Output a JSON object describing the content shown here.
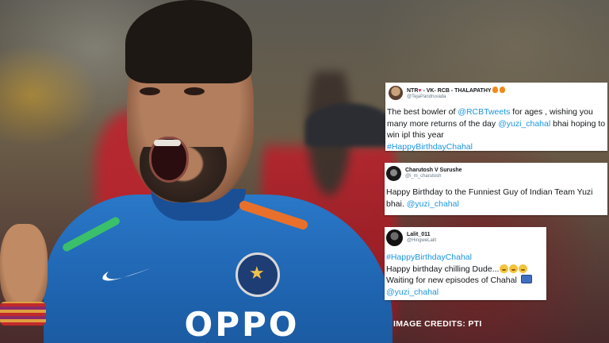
{
  "photo": {
    "sponsor_text": "OPPO"
  },
  "tweets": [
    {
      "display_name_before_heart": "NTR",
      "display_name_after_heart": " - VK- RCB - THALAPATHY ",
      "handle": "@TejaPandruvada",
      "parts": [
        {
          "text": "The best bowler of ",
          "link": false
        },
        {
          "text": "@RCBTweets",
          "link": true
        },
        {
          "text": "  for ages , wishing you many more returns of the day ",
          "link": false
        },
        {
          "text": "@yuzi_chahal",
          "link": true
        },
        {
          "text": "  bhai hoping to win ipl this year",
          "link": false
        },
        {
          "text": "#HappyBirthdayChahal",
          "link": true
        }
      ]
    },
    {
      "display_name": "Charutosh V Surushe",
      "handle": "@i_m_charutosh",
      "line1": "Happy Birthday to the Funniest Guy of Indian Team Yuzi bhai. ",
      "mention": "@yuzi_chahal"
    },
    {
      "display_name": "Lalit_011",
      "handle": "@HingweLalit",
      "hashtag": "#HappyBirthdayChahal",
      "line2": "Happy birthday chilling Dude...",
      "line3": "Waiting for new episodes of Chahal ",
      "mention": "@yuzi_chahal"
    }
  ],
  "credits": "IMAGE CREDITS: PTI"
}
